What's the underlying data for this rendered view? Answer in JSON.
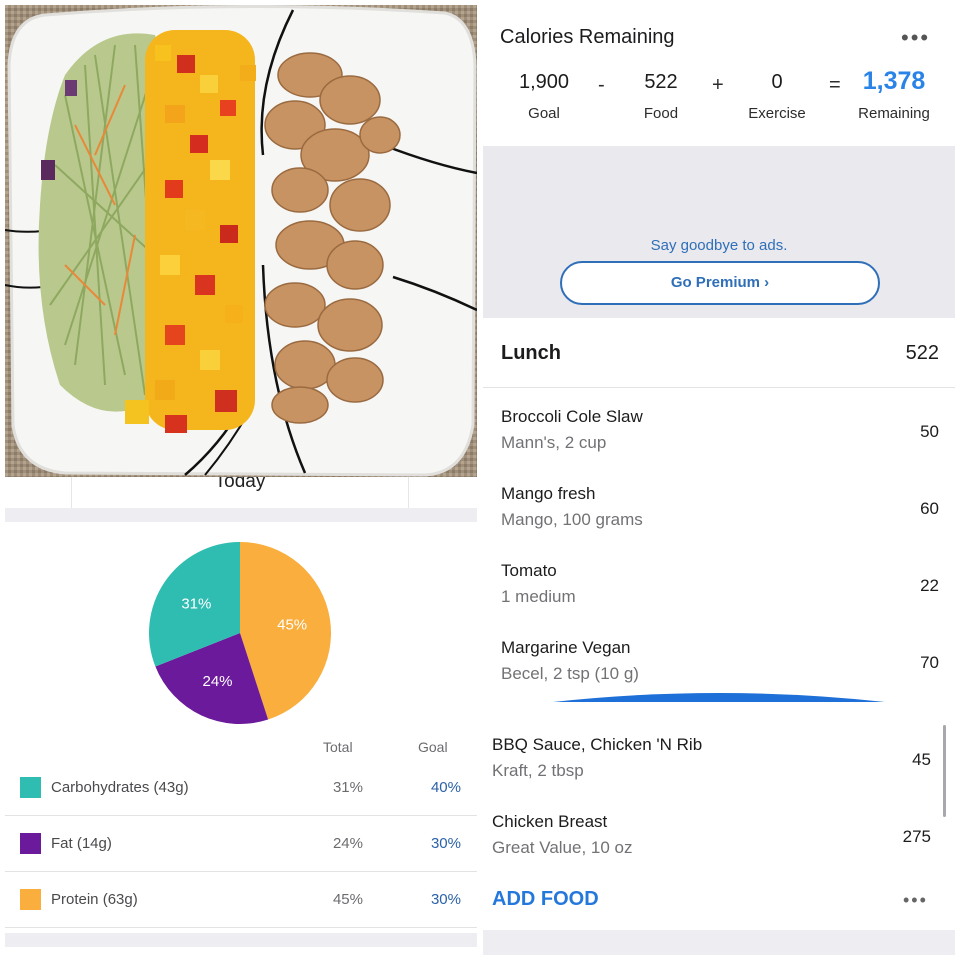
{
  "colors": {
    "carbs": "#2fbcb1",
    "fat": "#6a1a9a",
    "protein": "#f9ae3d",
    "accent_blue": "#2a83e6",
    "link_blue": "#2f6fb8"
  },
  "photo": {
    "description_icon": "food-photo"
  },
  "nutrition": {
    "date_label": "Today",
    "pie": [
      {
        "name": "carbs",
        "percent": 31,
        "label": "31%"
      },
      {
        "name": "fat",
        "percent": 24,
        "label": "24%"
      },
      {
        "name": "protein",
        "percent": 45,
        "label": "45%"
      }
    ],
    "headers": {
      "total": "Total",
      "goal": "Goal"
    },
    "rows": [
      {
        "name": "Carbohydrates (43g)",
        "total": "31%",
        "goal": "40%"
      },
      {
        "name": "Fat (14g)",
        "total": "24%",
        "goal": "30%"
      },
      {
        "name": "Protein (63g)",
        "total": "45%",
        "goal": "30%"
      }
    ]
  },
  "calories": {
    "title": "Calories Remaining",
    "goal_value": "1,900",
    "goal_label": "Goal",
    "minus": "-",
    "food_value": "522",
    "food_label": "Food",
    "plus": "+",
    "exercise_value": "0",
    "exercise_label": "Exercise",
    "equals": "=",
    "remaining_value": "1,378",
    "remaining_label": "Remaining",
    "more_icon": "more-horizontal-icon"
  },
  "ad": {
    "text": "Say goodbye to ads.",
    "button": "Go Premium ›"
  },
  "meal": {
    "title": "Lunch",
    "calories": "522",
    "items": [
      {
        "name": "Broccoli Cole Slaw",
        "detail": "Mann's, 2 cup",
        "cal": "50"
      },
      {
        "name": "Mango fresh",
        "detail": "Mango, 100 grams",
        "cal": "60"
      },
      {
        "name": "Tomato",
        "detail": "1 medium",
        "cal": "22"
      },
      {
        "name": "Margarine Vegan",
        "detail": "Becel, 2 tsp (10 g)",
        "cal": "70"
      },
      {
        "name": "BBQ Sauce, Chicken 'N Rib",
        "detail": "Kraft, 2 tbsp",
        "cal": "45"
      },
      {
        "name": "Chicken Breast",
        "detail": "Great Value, 10 oz",
        "cal": "275"
      }
    ],
    "add_food": "ADD FOOD",
    "more_icon": "more-horizontal-icon"
  }
}
